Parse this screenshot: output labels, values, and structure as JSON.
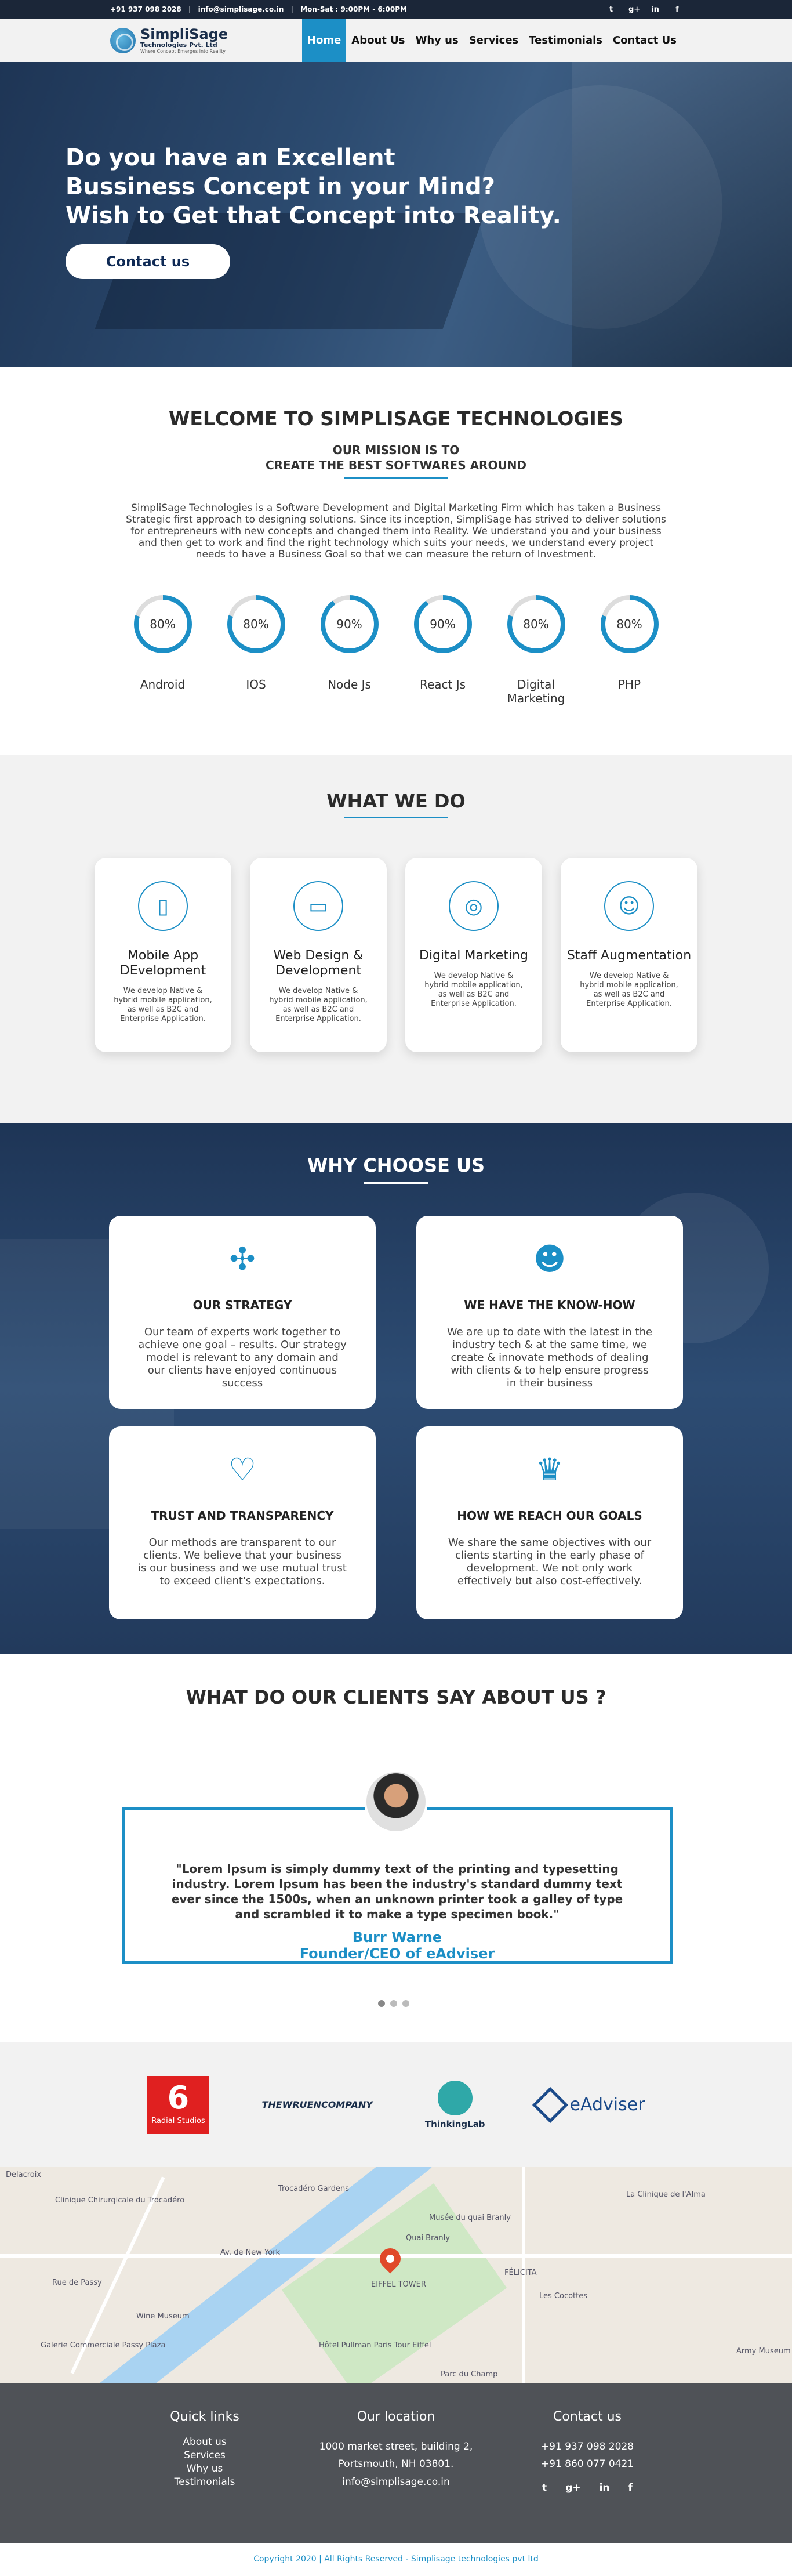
{
  "topbar": {
    "phone": "+91 937 098 2028",
    "email": "info@simplisage.co.in",
    "hours": "Mon-Sat : 9:00PM - 6:00PM",
    "social": [
      "twitter-icon",
      "google-plus-icon",
      "linkedin-icon",
      "facebook-icon"
    ]
  },
  "brand": {
    "name": "SimpliSage",
    "subtitle": "Technologies Pvt. Ltd",
    "tagline": "Where Concept Emerges into Reality"
  },
  "nav": [
    "Home",
    "About Us",
    "Why us",
    "Services",
    "Testimonials",
    "Contact Us"
  ],
  "hero": {
    "line1": "Do you have an Excellent",
    "line2": "Bussiness Concept in your Mind?",
    "line3": "Wish to Get that Concept into Reality.",
    "cta": "Contact us"
  },
  "welcome": {
    "title": "WELCOME TO SIMPLISAGE TECHNOLOGIES",
    "mission1": "OUR MISSION IS TO",
    "mission2": "CREATE THE BEST SOFTWARES AROUND",
    "about": "SimpliSage Technologies is a Software Development and Digital Marketing Firm which has taken a Business Strategic first approach to designing solutions. Since its inception, SimpliSage has strived to deliver solutions for entrepreneurs with new concepts and changed them into Reality. We understand you and your business and then get to work and find the right technology which suits your needs, we understand every project needs to have a Business Goal so that we can measure the return of Investment."
  },
  "skills": [
    {
      "name": "Android",
      "percent": 80,
      "label": "80%"
    },
    {
      "name": "IOS",
      "percent": 80,
      "label": "80%"
    },
    {
      "name": "Node Js",
      "percent": 90,
      "label": "90%"
    },
    {
      "name": "React Js",
      "percent": 90,
      "label": "90%"
    },
    {
      "name": "Digital Marketing",
      "percent": 80,
      "label": "80%"
    },
    {
      "name": "PHP",
      "percent": 80,
      "label": "80%"
    }
  ],
  "services": {
    "title": "WHAT WE DO",
    "items": [
      {
        "icon": "mobile-icon",
        "title": "Mobile App DEvelopment",
        "text": "We develop Native & hybrid mobile application, as well as B2C and Enterprise Application."
      },
      {
        "icon": "monitor-icon",
        "title": "Web Design & Development",
        "text": "We develop Native & hybrid mobile application, as well as B2C and Enterprise Application."
      },
      {
        "icon": "digital-marketing-icon",
        "title": "Digital Marketing",
        "text": "We develop Native & hybrid mobile application, as well as B2C and Enterprise Application."
      },
      {
        "icon": "team-icon",
        "title": "Staff Augmentation",
        "text": "We develop Native & hybrid mobile application, as well as B2C and Enterprise Application."
      }
    ]
  },
  "why": {
    "title": "WHY CHOOSE US",
    "items": [
      {
        "icon": "puzzle-icon",
        "title": "OUR STRATEGY",
        "text": "Our team of experts work together to achieve one goal – results. Our strategy model is relevant to any domain and our clients have enjoyed continuous success"
      },
      {
        "icon": "expert-icon",
        "title": "WE HAVE THE KNOW-HOW",
        "text": "We are up to date with the latest in the industry tech & at the same time, we create & innovate methods of dealing with clients & to help ensure progress in their business"
      },
      {
        "icon": "handshake-icon",
        "title": "TRUST AND TRANSPARENCY",
        "text": "Our methods are transparent to our clients. We believe that your business is our business and we use mutual trust to exceed client's expectations."
      },
      {
        "icon": "trophy-icon",
        "title": "HOW WE REACH OUR GOALS",
        "text": "We share the same objectives with our clients starting in the early phase of development. We not only work effectively but also cost-effectively."
      }
    ]
  },
  "testimonials": {
    "title": "WHAT DO OUR CLIENTS SAY ABOUT US ?",
    "quote": "\"Lorem Ipsum is simply dummy text of the printing and typesetting industry. Lorem Ipsum has been the industry's standard dummy text ever since the 1500s, when an unknown printer took a galley of type and scrambled it to make a type specimen book.\"",
    "name": "Burr Warne",
    "role": "Founder/CEO of eAdviser"
  },
  "partners": [
    "Radial Studios",
    "THEWRUENCOMPANY",
    "ThinkingLab",
    "eAdviser"
  ],
  "map": {
    "labels": [
      "Trocadéro Gardens",
      "Musée du quai Branly",
      "EIFFEL TOWER",
      "Wine Museum",
      "Rue de Passy",
      "Av. de New York",
      "Quai Branly",
      "Hôtel Pullman Paris Tour Eiffel",
      "Parc du Champ",
      "Clinique Chirurgicale du Trocadéro",
      "La Clinique de l'Alma",
      "FÉLICITA",
      "Les Cocottes",
      "Delacroix",
      "Galerie Commerciale Passy Plaza",
      "Army Museum"
    ]
  },
  "footer": {
    "quick_title": "Quick links",
    "quick_links": [
      "About us",
      "Services",
      "Why us",
      "Testimonials"
    ],
    "loc_title": "Our location",
    "address1": "1000 market street, building 2,",
    "address2": "Portsmouth, NH 03801.",
    "loc_email": "info@simplisage.co.in",
    "contact_title": "Contact us",
    "phone1": "+91 937 098 2028",
    "phone2": "+91 860 077 0421",
    "copyright": "Copyright 2020 | All Rights Reserved - Simplisage technologies pvt ltd"
  },
  "colors": {
    "accent": "#1c8fc6",
    "topbar": "#1b2638",
    "footer": "#4f5257"
  }
}
